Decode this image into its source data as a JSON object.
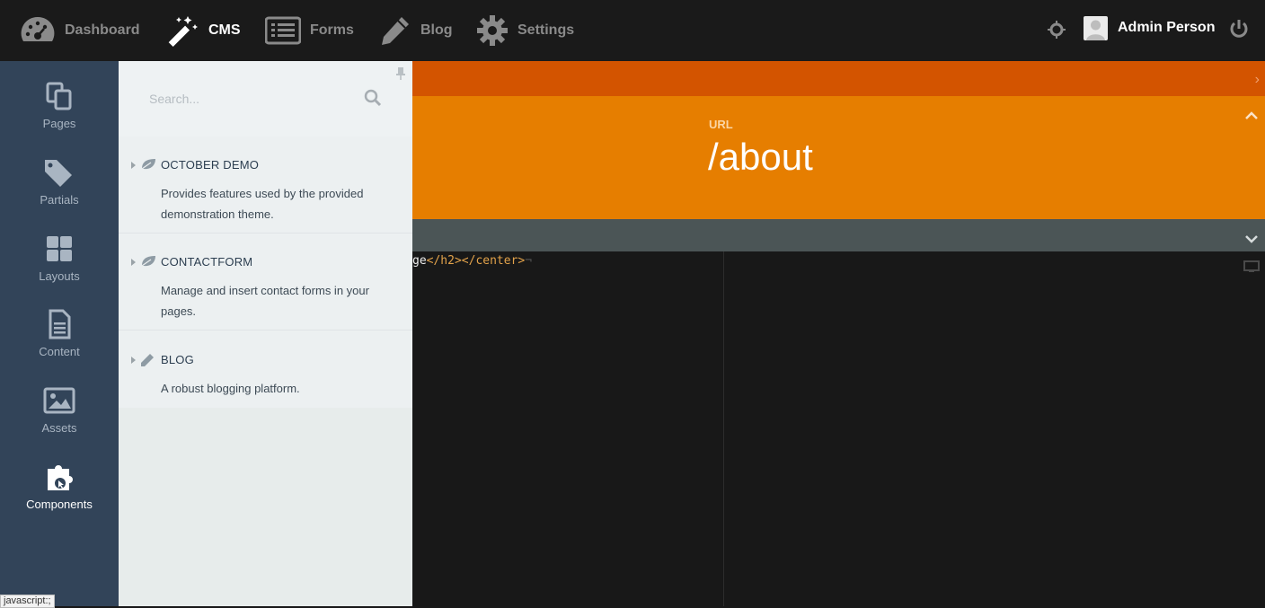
{
  "topnav": {
    "items": [
      {
        "label": "Dashboard",
        "icon": "dashboard-gauge-icon"
      },
      {
        "label": "CMS",
        "icon": "magic-wand-icon",
        "active": true
      },
      {
        "label": "Forms",
        "icon": "forms-list-icon"
      },
      {
        "label": "Blog",
        "icon": "pencil-icon"
      },
      {
        "label": "Settings",
        "icon": "gear-icon"
      }
    ],
    "user_name": "Admin Person"
  },
  "sidebar": {
    "items": [
      {
        "label": "Pages",
        "icon": "pages-icon"
      },
      {
        "label": "Partials",
        "icon": "tags-icon"
      },
      {
        "label": "Layouts",
        "icon": "layouts-grid-icon"
      },
      {
        "label": "Content",
        "icon": "document-icon"
      },
      {
        "label": "Assets",
        "icon": "image-icon"
      },
      {
        "label": "Components",
        "icon": "puzzle-icon",
        "active": true
      }
    ]
  },
  "panel": {
    "search_placeholder": "Search...",
    "components": [
      {
        "title": "OCTOBER DEMO",
        "description": "Provides features used by the provided demonstration theme.",
        "icon": "leaf-icon"
      },
      {
        "title": "CONTACTFORM",
        "description": "Manage and insert contact forms in your pages.",
        "icon": "leaf-icon"
      },
      {
        "title": "BLOG",
        "description": "A robust blogging platform.",
        "icon": "pencil-icon"
      }
    ]
  },
  "page": {
    "url_label": "URL",
    "url_value": "/about"
  },
  "editor": {
    "code_text": "ge",
    "code_tags": "</h2></center>",
    "code_pilcrow": "¬"
  },
  "status_bar": {
    "text": "javascript:;"
  },
  "colors": {
    "topbar": "#1a1a1a",
    "sidebar": "#324459",
    "panel": "#ecf0f1",
    "orange_dark": "#d35400",
    "orange": "#e67e00",
    "grey_bar": "#4b5556",
    "editor_bg": "#181818"
  }
}
